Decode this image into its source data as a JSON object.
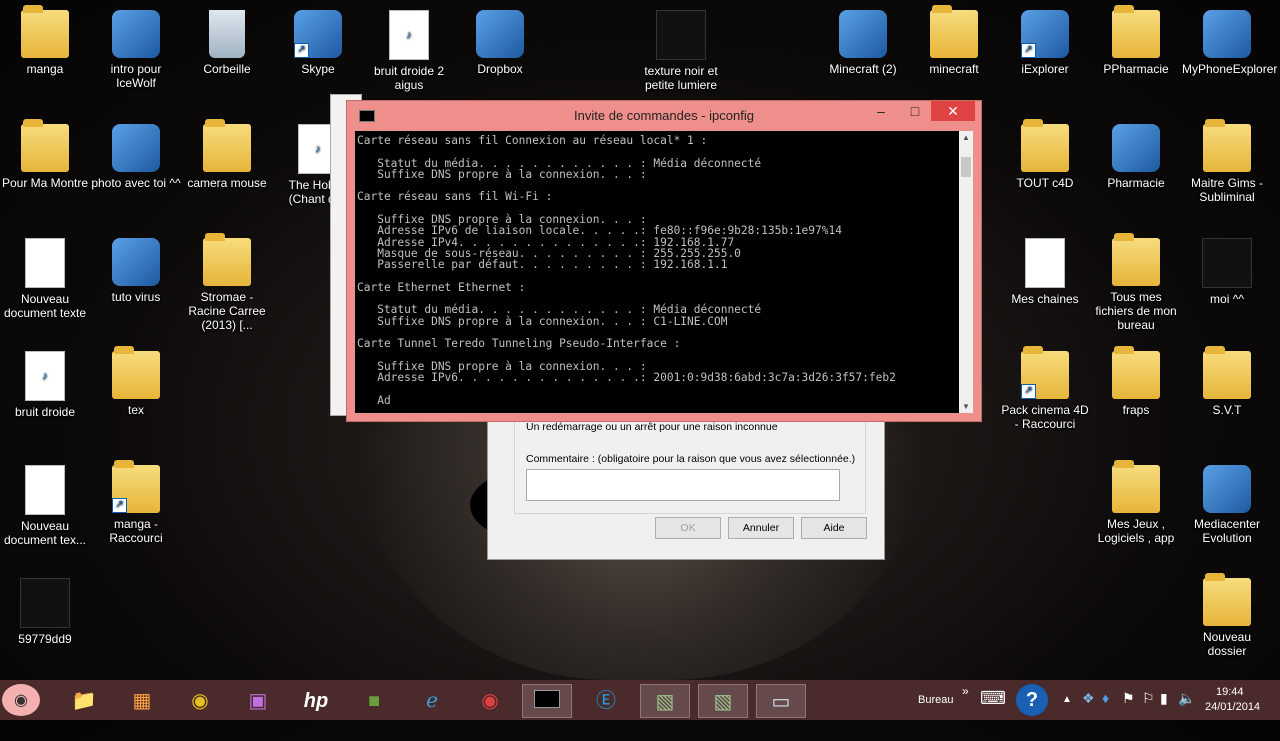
{
  "desktop": {
    "icons": [
      {
        "label": "manga",
        "kind": "folder"
      },
      {
        "label": "intro pour IceWolf",
        "kind": "app"
      },
      {
        "label": "Corbeille",
        "kind": "bin"
      },
      {
        "label": "Skype",
        "kind": "app"
      },
      {
        "label": "bruit droide 2 aigus",
        "kind": "mp3"
      },
      {
        "label": "Dropbox",
        "kind": "app"
      },
      {
        "label": "texture noir et petite lumiere",
        "kind": "image"
      },
      {
        "label": "Minecraft (2)",
        "kind": "app"
      },
      {
        "label": "minecraft",
        "kind": "folder"
      },
      {
        "label": "iExplorer",
        "kind": "app"
      },
      {
        "label": "PPharmacie",
        "kind": "folder"
      },
      {
        "label": "MyPhoneExplorer",
        "kind": "app"
      },
      {
        "label": "Pour Ma Montre",
        "kind": "folder"
      },
      {
        "label": "photo avec toi ^^",
        "kind": "app"
      },
      {
        "label": "camera mouse",
        "kind": "folder"
      },
      {
        "label": "The Hobbit (Chant des",
        "kind": "mp3"
      },
      {
        "label": "TOUT c4D",
        "kind": "folder"
      },
      {
        "label": "Pharmacie",
        "kind": "app"
      },
      {
        "label": "Maitre Gims - Subliminal",
        "kind": "folder"
      },
      {
        "label": "Nouveau document texte",
        "kind": "doc"
      },
      {
        "label": "tuto virus",
        "kind": "app"
      },
      {
        "label": "Stromae - Racine Carree (2013) [...",
        "kind": "folder"
      },
      {
        "label": "Mes chaines",
        "kind": "doc"
      },
      {
        "label": "Tous mes fichiers de mon bureau",
        "kind": "folder"
      },
      {
        "label": "moi ^^",
        "kind": "image"
      },
      {
        "label": "bruit droide",
        "kind": "mp3"
      },
      {
        "label": "tex",
        "kind": "folder"
      },
      {
        "label": "Pack cinema 4D - Raccourci",
        "kind": "folder"
      },
      {
        "label": "fraps",
        "kind": "folder"
      },
      {
        "label": "S.V.T",
        "kind": "folder"
      },
      {
        "label": "Nouveau document tex...",
        "kind": "doc"
      },
      {
        "label": "manga - Raccourci",
        "kind": "folder"
      },
      {
        "label": "Mes Jeux , Logiciels , app",
        "kind": "folder"
      },
      {
        "label": "Mediacenter Evolution",
        "kind": "app"
      },
      {
        "label": "59779dd9",
        "kind": "image"
      },
      {
        "label": "Nouveau dossier",
        "kind": "folder"
      }
    ]
  },
  "cmd_window": {
    "title": "Invite de commandes - ipconfig",
    "minimize": "‒",
    "maximize": "□",
    "close": "✕",
    "output": "Carte réseau sans fil Connexion au réseau local* 1 :\n\n   Statut du média. . . . . . . . . . . . : Média déconnecté\n   Suffixe DNS propre à la connexion. . . :\n\nCarte réseau sans fil Wi-Fi :\n\n   Suffixe DNS propre à la connexion. . . :\n   Adresse IPv6 de liaison locale. . . . .: fe80::f96e:9b28:135b:1e97%14\n   Adresse IPv4. . . . . . . . . . . . . .: 192.168.1.77\n   Masque de sous-réseau. . . . . . . . . : 255.255.255.0\n   Passerelle par défaut. . . . . . . . . : 192.168.1.1\n\nCarte Ethernet Ethernet :\n\n   Statut du média. . . . . . . . . . . . : Média déconnecté\n   Suffixe DNS propre à la connexion. . . : C1-LINE.COM\n\nCarte Tunnel Teredo Tunneling Pseudo-Interface :\n\n   Suffixe DNS propre à la connexion. . . :\n   Adresse IPv6. . . . . . . . . . . . . .: 2001:0:9d38:6abd:3c7a:3d26:3f57:feb2\n\n   Ad"
  },
  "shutdown_dialog": {
    "reason": "Un redémarrage ou un arrêt pour une raison inconnue",
    "comment_label": "Commentaire : (obligatoire pour la raison que vous avez sélectionnée.)",
    "comment_value": "",
    "ok": "OK",
    "cancel": "Annuler",
    "help": "Aide"
  },
  "taskbar": {
    "apps": [
      "start-pig-icon",
      "file-explorer-icon",
      "photo-app-icon",
      "media-icon",
      "settings-icon",
      "hp-icon",
      "minecraft-icon",
      "internet-explorer-icon",
      "chrome-icon",
      "cmd-icon",
      "skype-icon",
      "minecraft-launcher-icon",
      "game-icon",
      "window-icon"
    ],
    "hp_label": "hp",
    "toolbar_label": "Bureau",
    "chevron": "»",
    "time": "19:44",
    "date": "24/01/2014"
  }
}
